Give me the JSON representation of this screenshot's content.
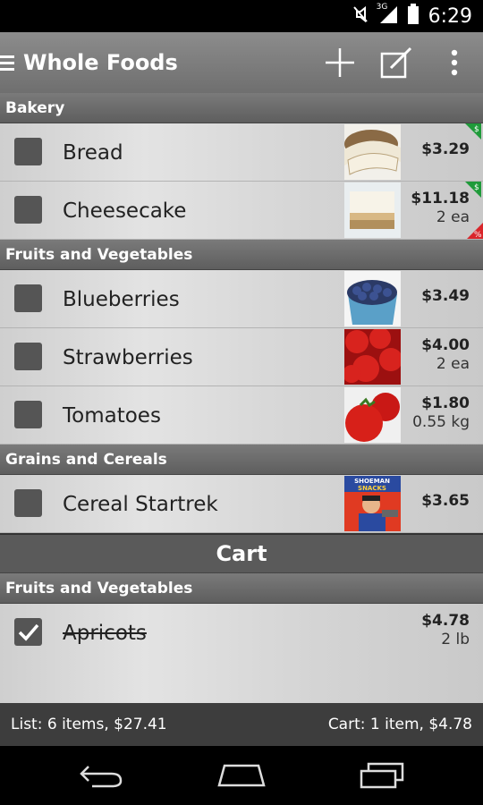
{
  "statusbar": {
    "time": "6:29",
    "network": "3G"
  },
  "toolbar": {
    "title": "Whole Foods"
  },
  "list": {
    "categories": [
      {
        "name": "Bakery",
        "items": [
          {
            "name": "Bread",
            "price": "$3.29",
            "qty": "",
            "thumb": "bread",
            "badges": [
              "dollar-badge"
            ]
          },
          {
            "name": "Cheesecake",
            "price": "$11.18",
            "qty": "2 ea",
            "thumb": "cheesecake",
            "badges": [
              "dollar-badge",
              "percent-badge"
            ]
          }
        ]
      },
      {
        "name": "Fruits and Vegetables",
        "items": [
          {
            "name": "Blueberries",
            "price": "$3.49",
            "qty": "",
            "thumb": "blueberries",
            "badges": []
          },
          {
            "name": "Strawberries",
            "price": "$4.00",
            "qty": "2 ea",
            "thumb": "strawberries",
            "badges": []
          },
          {
            "name": "Tomatoes",
            "price": "$1.80",
            "qty": "0.55 kg",
            "thumb": "tomatoes",
            "badges": []
          }
        ]
      },
      {
        "name": "Grains and Cereals",
        "items": [
          {
            "name": "Cereal Startrek",
            "price": "$3.65",
            "qty": "",
            "thumb": "cereal",
            "badges": []
          }
        ]
      }
    ]
  },
  "cart": {
    "header": "Cart",
    "categories": [
      {
        "name": "Fruits and Vegetables",
        "items": [
          {
            "name": "Apricots",
            "price": "$4.78",
            "qty": "2 lb",
            "checked": true
          }
        ]
      }
    ]
  },
  "summary": {
    "list": "List: 6 items, $27.41",
    "cart": "Cart: 1 item, $4.78"
  },
  "cereal_box_text": "SHOEMAN SNACKS",
  "colors": {
    "badge_green": "#1f9a3a",
    "badge_red": "#d9262b",
    "toolbar": "#7d7d7d"
  }
}
